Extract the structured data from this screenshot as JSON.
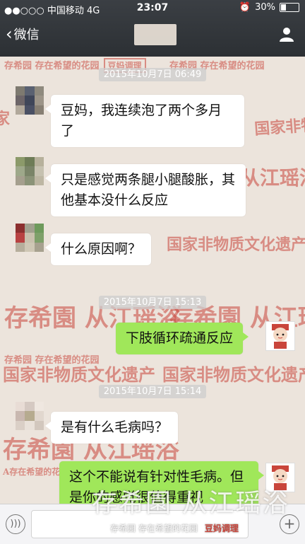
{
  "status_bar": {
    "carrier": "●●○○○ 中国移动  4G",
    "time": "23:07",
    "battery_text": "30%",
    "battery_level": 0.3
  },
  "nav": {
    "back_label": "微信"
  },
  "watermarks": {
    "row1": "存希园  存在希望的花园",
    "stamp1": "豆妈调理",
    "heritage": "国家非物质文化遗产",
    "calligraphy": "存希園 从江瑶浴",
    "calligraphy_right": "从江瑶浴",
    "red_small": "A存在希望的花园"
  },
  "messages": [
    {
      "type": "timestamp",
      "text": "2015年10月7日 06:49"
    },
    {
      "type": "incoming",
      "text": "豆妈，我连续泡了两个多月了"
    },
    {
      "type": "incoming",
      "text": "只是感觉两条腿小腿酸胀，其他基本没什么反应"
    },
    {
      "type": "incoming",
      "text": "什么原因啊？"
    },
    {
      "type": "timestamp",
      "text": "2015年10月7日 15:13"
    },
    {
      "type": "outgoing",
      "text": "下肢循环疏通反应"
    },
    {
      "type": "timestamp",
      "text": "2015年10月7日 15:14"
    },
    {
      "type": "incoming",
      "text": "是有什么毛病吗？"
    },
    {
      "type": "outgoing",
      "text": "这个不能说有针对性毛病。但是你的感觉很值得重视"
    }
  ],
  "overlay": {
    "title": "存希園 从江瑶浴",
    "subtitle": "存希园  存在希望的花园",
    "badge": "豆妈调理"
  },
  "colors": {
    "outgoing_bubble": "#a0e75a",
    "nav_bg": "#2c3034",
    "watermark_red": "#c9453b"
  }
}
